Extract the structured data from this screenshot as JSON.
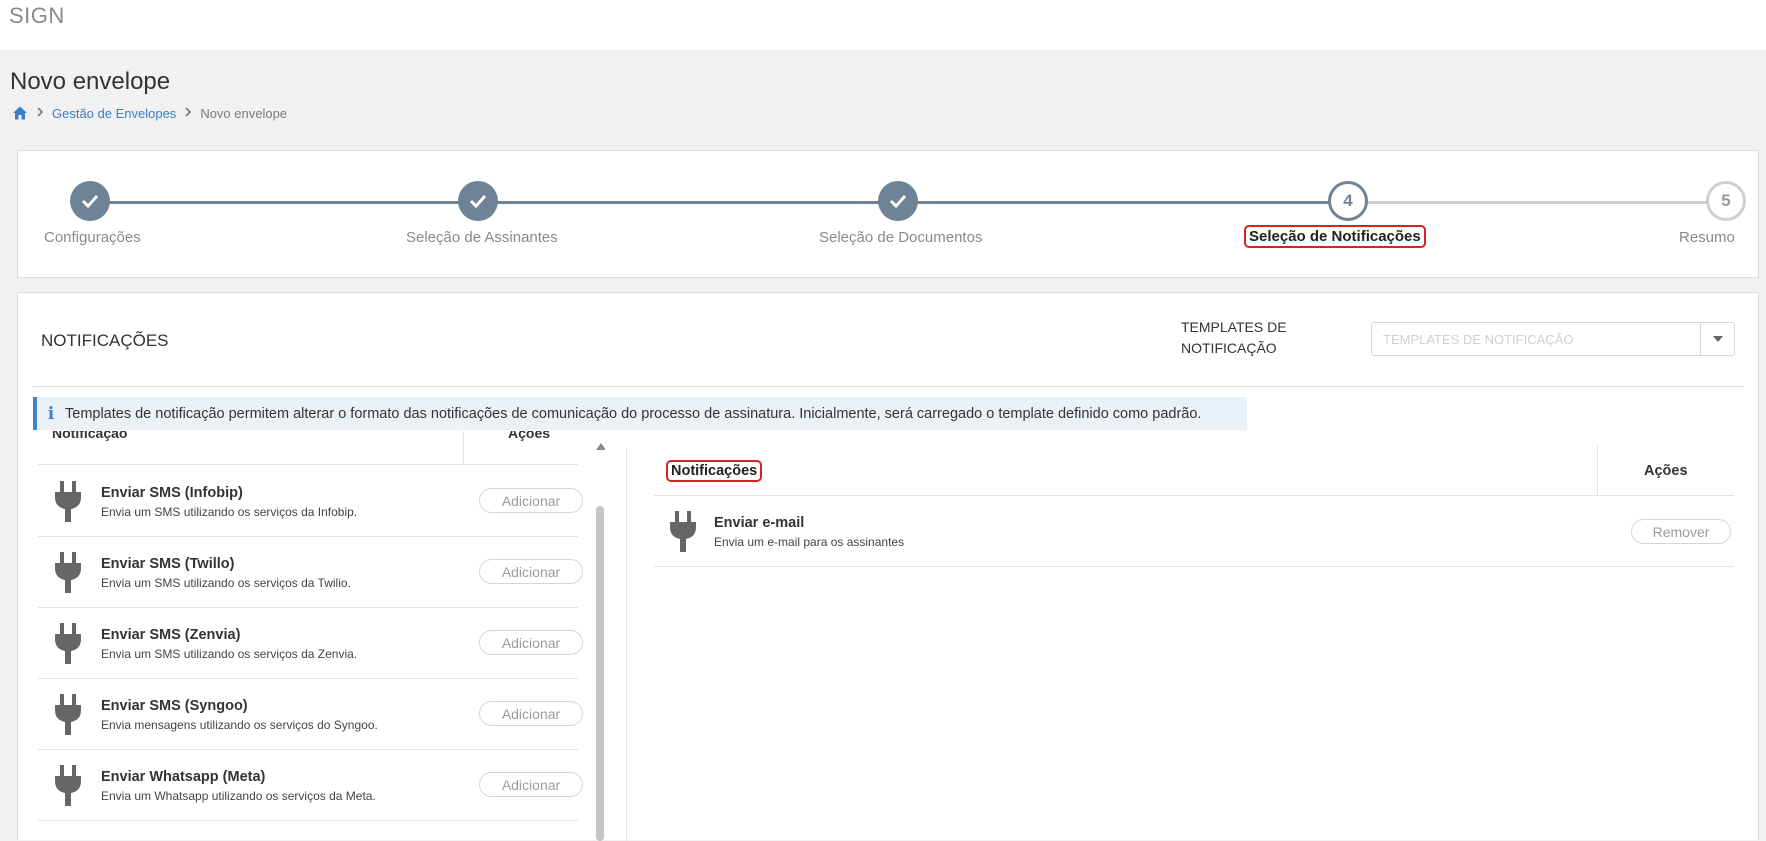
{
  "app": {
    "brand": "SIGN"
  },
  "page": {
    "title": "Novo envelope"
  },
  "breadcrumb": {
    "items": [
      "Gestão de Envelopes",
      "Novo envelope"
    ]
  },
  "stepper": {
    "current_step": 4,
    "steps": [
      {
        "label": "Configurações",
        "status": "done",
        "number": ""
      },
      {
        "label": "Seleção de Assinantes",
        "status": "done",
        "number": ""
      },
      {
        "label": "Seleção de Documentos",
        "status": "done",
        "number": ""
      },
      {
        "label": "Seleção de Notificações",
        "status": "active",
        "number": "4"
      },
      {
        "label": "Resumo",
        "status": "todo",
        "number": "5"
      }
    ]
  },
  "notifications": {
    "section_title": "NOTIFICAÇÕES",
    "templates_label_line1": "TEMPLATES DE",
    "templates_label_line2": "NOTIFICAÇÃO",
    "templates_placeholder": "TEMPLATES DE NOTIFICAÇÃO",
    "info_text": "Templates de notificação permitem alterar o formato das notificações de comunicação do processo de assinatura. Inicialmente, será carregado o template definido como padrão.",
    "available": {
      "col_notification": "Notificação",
      "col_actions": "Ações",
      "add_label": "Adicionar",
      "items": [
        {
          "title": "Enviar SMS (Infobip)",
          "description": "Envia um SMS utilizando os serviços da Infobip."
        },
        {
          "title": "Enviar SMS (Twillo)",
          "description": "Envia um SMS utilizando os serviços da Twilio."
        },
        {
          "title": "Enviar SMS (Zenvia)",
          "description": "Envia um SMS utilizando os serviços da Zenvia."
        },
        {
          "title": "Enviar SMS (Syngoo)",
          "description": "Envia mensagens utilizando os serviços do Syngoo."
        },
        {
          "title": "Enviar Whatsapp (Meta)",
          "description": "Envia um Whatsapp utilizando os serviços da Meta."
        }
      ]
    },
    "selected": {
      "col_notification": "Notificações",
      "col_actions": "Ações",
      "remove_label": "Remover",
      "items": [
        {
          "title": "Enviar e-mail",
          "description": "Envia um e-mail para os assinantes"
        }
      ]
    }
  },
  "colors": {
    "step_done": "#6e8496",
    "step_todo": "#cfcfcf",
    "link": "#3b7fc4",
    "highlight_border": "#d62222",
    "info_accent": "#3a86c8"
  },
  "icons": {
    "home": "home-icon",
    "breadcrumb_separator": "chevron-right-icon",
    "step_done": "check-icon",
    "notification": "plug-icon",
    "info": "info-icon",
    "dropdown": "caret-down-icon"
  }
}
